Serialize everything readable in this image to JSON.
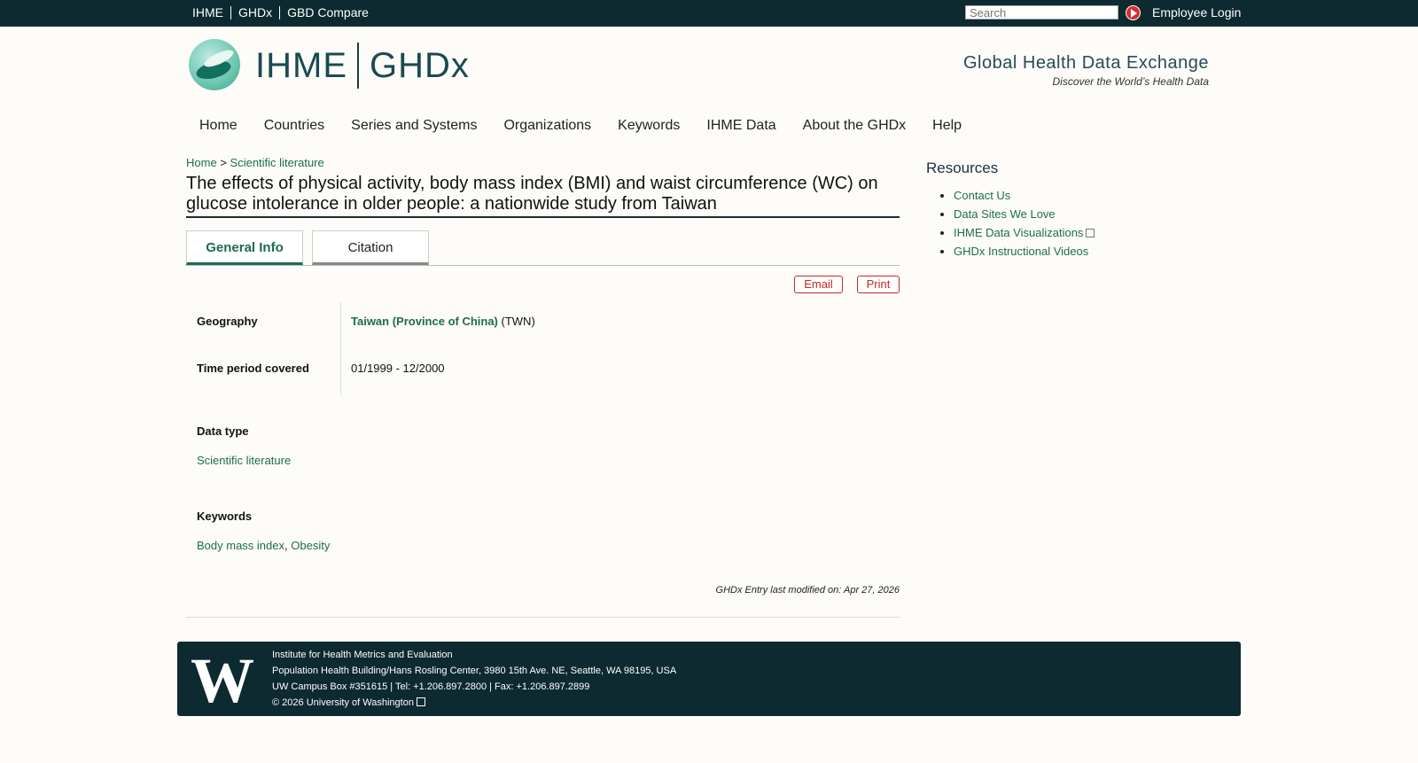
{
  "topbar": {
    "links": [
      "IHME",
      "GHDx",
      "GBD Compare"
    ],
    "search_placeholder": "Search",
    "login": "Employee Login"
  },
  "header": {
    "logo_ihme": "IHME",
    "logo_ghdx": "GHDx",
    "site_title": "Global Health Data Exchange",
    "tagline": "Discover the World’s Health Data"
  },
  "nav": [
    "Home",
    "Countries",
    "Series and Systems",
    "Organizations",
    "Keywords",
    "IHME Data",
    "About the GHDx",
    "Help"
  ],
  "breadcrumb": {
    "home": "Home",
    "sep": ">",
    "current": "Scientific literature"
  },
  "page_title": "The effects of physical activity, body mass index (BMI) and waist circumference (WC) on glucose intolerance in older people: a nationwide study from Taiwan",
  "tabs": {
    "general": "General Info",
    "citation": "Citation"
  },
  "actions": {
    "email": "Email",
    "print": "Print"
  },
  "info": {
    "geography_label": "Geography",
    "geography_link": "Taiwan (Province of China)",
    "geography_code": "(TWN)",
    "time_label": "Time period covered",
    "time_value": "01/1999 - 12/2000",
    "datatype_label": "Data type",
    "datatype_value": "Scientific literature",
    "keywords_label": "Keywords",
    "keyword_1": "Body mass index",
    "keyword_sep": ",",
    "keyword_2": "Obesity"
  },
  "modified": "GHDx Entry last modified on: Apr 27, 2026",
  "sidebar": {
    "title": "Resources",
    "items": [
      "Contact Us",
      "Data Sites We Love",
      "IHME Data Visualizations",
      "GHDx Instructional Videos"
    ]
  },
  "footer": {
    "logo": "W",
    "line1": "Institute for Health Metrics and Evaluation",
    "line2": "Population Health Building/Hans Rosling Center, 3980 15th Ave. NE, Seattle, WA 98195, USA",
    "line3": "UW Campus Box #351615 | Tel: +1.206.897.2800 | Fax: +1.206.897.2899",
    "copyright": "© 2026",
    "uw_link": "University of Washington"
  }
}
